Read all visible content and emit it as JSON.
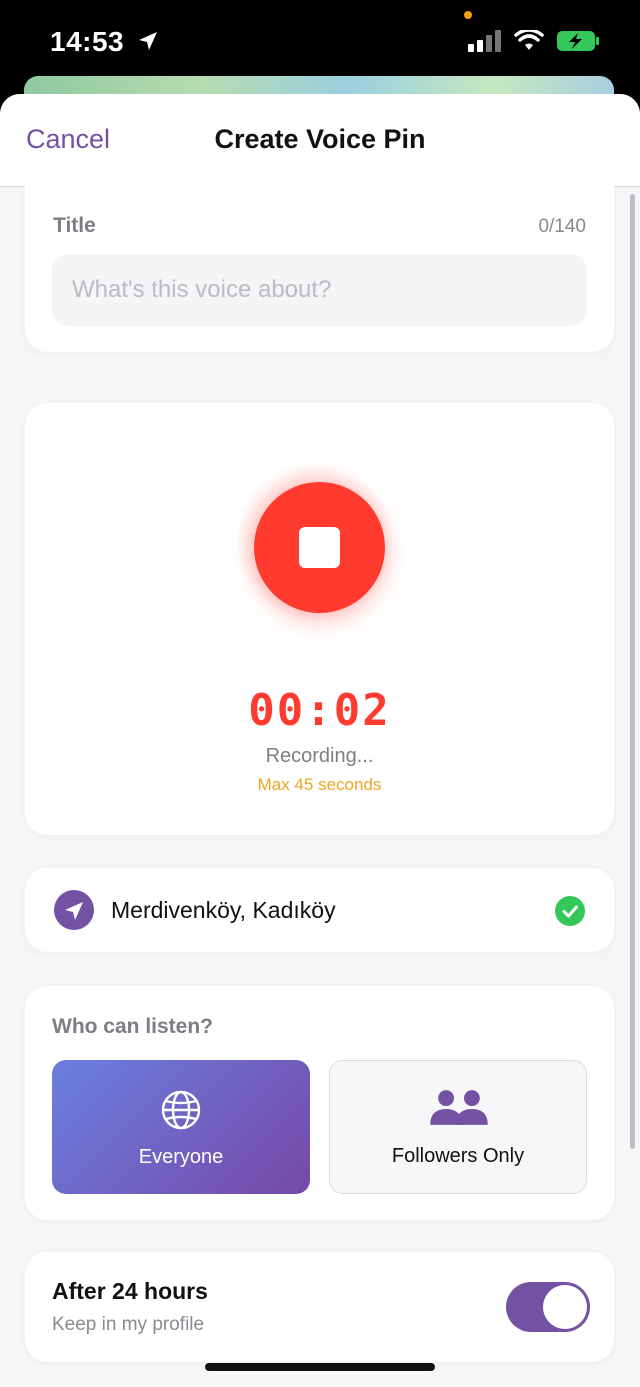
{
  "status_bar": {
    "time": "14:53"
  },
  "nav": {
    "cancel_label": "Cancel",
    "title": "Create Voice Pin"
  },
  "title_field": {
    "label": "Title",
    "counter": "0/140",
    "value": "",
    "placeholder": "What's this voice about?"
  },
  "recorder": {
    "timer": "00:02",
    "status": "Recording...",
    "max_note": "Max 45 seconds",
    "accent_color": "#ff3b30"
  },
  "location": {
    "name": "Merdivenköy, Kadıköy",
    "icon": "location-arrow-icon",
    "verified_icon": "check-circle-icon"
  },
  "audience": {
    "label": "Who can listen?",
    "options": [
      {
        "label": "Everyone",
        "icon": "globe-icon",
        "selected": true
      },
      {
        "label": "Followers Only",
        "icon": "people-icon",
        "selected": false
      }
    ]
  },
  "expiry": {
    "title": "After 24 hours",
    "subtitle": "Keep in my profile",
    "toggle_on": true
  },
  "colors": {
    "brand_purple": "#7452a3",
    "success_green": "#34c759",
    "warning_orange": "#f0a521"
  }
}
